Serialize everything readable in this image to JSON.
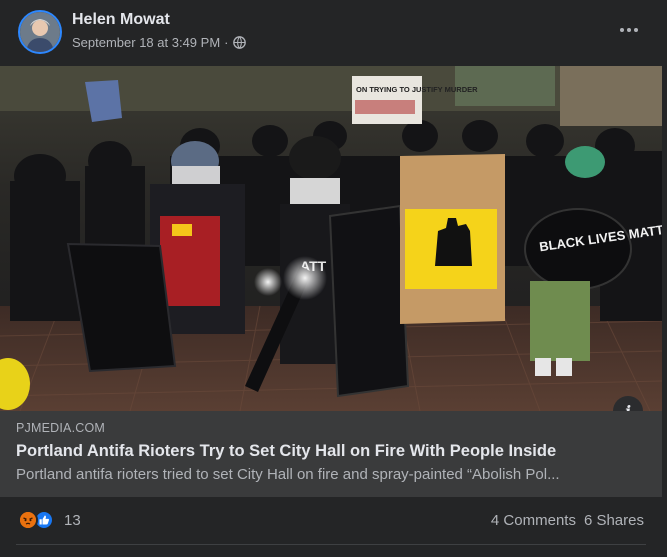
{
  "post": {
    "author": "Helen Mowat",
    "timestamp": "September 18 at 3:49 PM",
    "separator": "·",
    "privacy_icon": "globe-icon",
    "menu_icon": "more-options-icon"
  },
  "photo": {
    "signs": {
      "top_sign": "ON TRYING TO JUSTIFY MURDER",
      "shield_text": "BLACK LIVES MATTER",
      "small_sign": "ATT"
    },
    "info_icon": "info-icon"
  },
  "link": {
    "domain": "PJMEDIA.COM",
    "title": "Portland Antifa Rioters Try to Set City Hall on Fire With People Inside",
    "description": "Portland antifa rioters tried to set City Hall on fire and spray-painted “Abolish Pol..."
  },
  "footer": {
    "reaction_count": "13",
    "comments": "4 Comments",
    "shares": "6 Shares"
  },
  "colors": {
    "background": "#242526",
    "link_box": "#3a3b3c",
    "like_blue": "#1877f2",
    "angry_orange": "#e9710f",
    "avatar_ring": "#2d88ff"
  }
}
